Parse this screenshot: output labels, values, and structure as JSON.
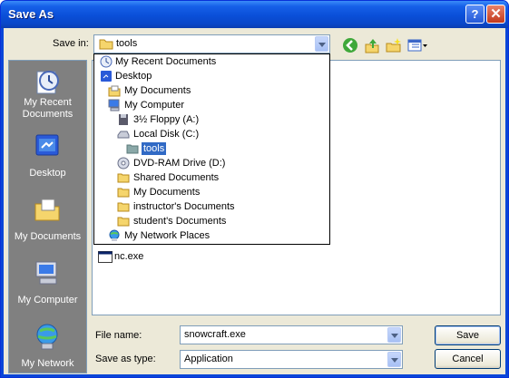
{
  "window": {
    "title": "Save As"
  },
  "titlebar_buttons": {
    "help": "?",
    "close": "✕"
  },
  "save_in": {
    "label": "Save in:",
    "value": "tools"
  },
  "toolbar": {
    "icons": [
      "back-icon",
      "up-folder-icon",
      "new-folder-icon",
      "views-menu-icon"
    ]
  },
  "places": [
    {
      "label": "My Recent Documents",
      "icon": "recent-documents-icon"
    },
    {
      "label": "Desktop",
      "icon": "desktop-icon"
    },
    {
      "label": "My Documents",
      "icon": "my-documents-icon"
    },
    {
      "label": "My Computer",
      "icon": "my-computer-icon"
    },
    {
      "label": "My Network",
      "icon": "my-network-icon"
    }
  ],
  "dropdown": [
    {
      "label": "My Recent Documents",
      "icon": "recent-documents-icon",
      "level": 0
    },
    {
      "label": "Desktop",
      "icon": "desktop-icon",
      "level": 0
    },
    {
      "label": "My Documents",
      "icon": "my-documents-icon",
      "level": 1
    },
    {
      "label": "My Computer",
      "icon": "my-computer-icon",
      "level": 1
    },
    {
      "label": "3½ Floppy (A:)",
      "icon": "floppy-icon",
      "level": 2
    },
    {
      "label": "Local Disk (C:)",
      "icon": "local-disk-icon",
      "level": 2
    },
    {
      "label": "tools",
      "icon": "folder-open-icon",
      "level": 3,
      "selected": true
    },
    {
      "label": "DVD-RAM Drive (D:)",
      "icon": "dvd-drive-icon",
      "level": 2
    },
    {
      "label": "Shared Documents",
      "icon": "folder-icon",
      "level": 2
    },
    {
      "label": "My Documents",
      "icon": "folder-icon",
      "level": 2
    },
    {
      "label": "instructor's Documents",
      "icon": "folder-icon",
      "level": 2
    },
    {
      "label": "student's Documents",
      "icon": "folder-icon",
      "level": 2
    },
    {
      "label": "My Network Places",
      "icon": "network-places-icon",
      "level": 1
    }
  ],
  "files": [
    {
      "name": "nc.exe",
      "icon": "exe-file-icon"
    }
  ],
  "file_name": {
    "label": "File name:",
    "value": "snowcraft.exe"
  },
  "save_as_type": {
    "label": "Save as type:",
    "value": "Application"
  },
  "buttons": {
    "save": "Save",
    "cancel": "Cancel"
  }
}
